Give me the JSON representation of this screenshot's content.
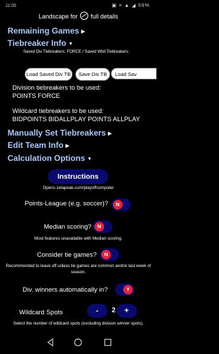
{
  "status_bar": {
    "time": "11:05",
    "icons": "▣ ⌗ ▲ ◢ 59%"
  },
  "banner": {
    "prefix": "Landscape for",
    "suffix": "full details"
  },
  "sections": {
    "remaining_games": "Remaining Games",
    "tiebreaker_info": "Tiebreaker Info",
    "manually_set": "Manually Set Tiebreakers",
    "edit_team": "Edit Team Info",
    "calc_options": "Calculation Options"
  },
  "tiebreaker": {
    "saved_line": "Saved Div Tiebreakers: FORCE / Saved Wild Tiebreakers:",
    "buttons": [
      "Load Saved Div TB",
      "Save Div TB",
      "Load Sav"
    ],
    "division_heading": "Division tiebreakers to be used:",
    "division_value": "POINTS FORCE",
    "wildcard_heading": "Wildcard tiebreakers to be used:",
    "wildcard_value": "BIDPOINTS BIDALLPLAY POINTS ALLPLAY"
  },
  "options": {
    "instructions_label": "Instructions",
    "instructions_note": "Opens zelapeak.com/playoffcomputer",
    "points_league_label": "Points-League (e.g. soccer)?",
    "points_league_value": "N",
    "median_label": "Median scoring?",
    "median_value": "N",
    "median_note": "Most features unavailable with Median scoring.",
    "tie_games_label": "Consider tie games?",
    "tie_games_value": "N",
    "tie_games_note": "Recommended to leave off unless tie games are common and/or last week of season.",
    "div_winners_label": "Div. winners automatically in?",
    "div_winners_value": "Y",
    "wildcard_label": "Wildcard Spots",
    "wildcard_minus": "-",
    "wildcard_count": "2",
    "wildcard_plus": "+",
    "wildcard_note": "Select the number of wildcard spots (excluding division winner spots)."
  },
  "colors": {
    "accent": "#a9c8ff",
    "navy": "#0a0a6e",
    "toggle": "#e0243f"
  }
}
